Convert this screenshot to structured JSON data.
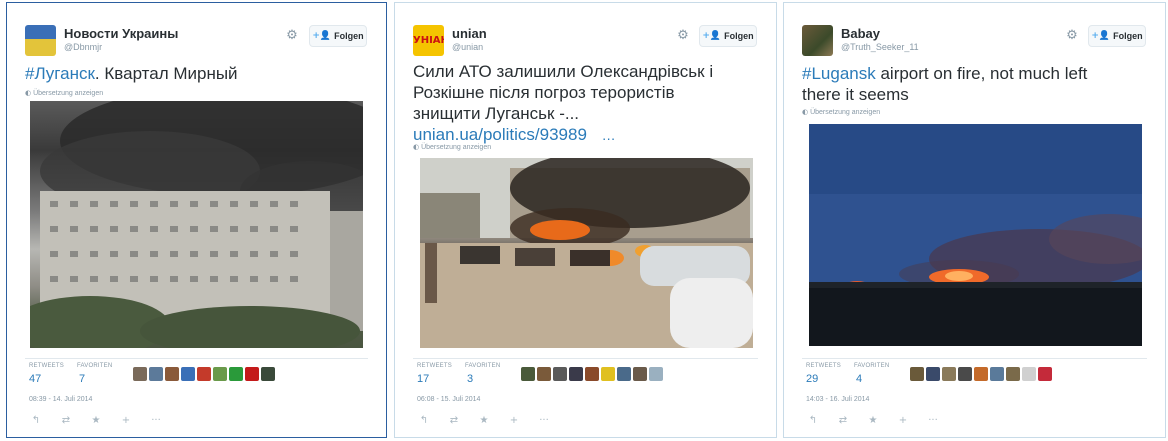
{
  "follow_label": "Folgen",
  "translate_label": "Übersetzung anzeigen",
  "retweets_label": "RETWEETS",
  "favorites_label": "FAVORITEN",
  "tweets": [
    {
      "fullname": "Новости Украины",
      "handle": "@Dbnmjr",
      "hashtag": "#Луганск",
      "text_after": ". Квартал Мирный",
      "retweets": "47",
      "favorites": "7",
      "timestamp": "08:39 - 14. Juli 2014",
      "favoriter_colors": [
        "#7a6a5a",
        "#5c7a9a",
        "#8a5a3a",
        "#3a6fb7",
        "#c43a2a",
        "#6a9a4a",
        "#2a9a3a",
        "#c41a1a",
        "#3a4a3a"
      ]
    },
    {
      "fullname": "unian",
      "handle": "@unian",
      "avatar_text": "УНІАН",
      "line1": "Сили АТО залишили Олександрівськ і",
      "line2": "Розкішне після погроз терористів",
      "line3": "знищити Луганськ -...",
      "link": "unian.ua/politics/93989",
      "link_suffix": "…",
      "retweets": "17",
      "favorites": "3",
      "timestamp": "06:08 - 15. Juli 2014",
      "favoriter_colors": [
        "#4a5a3a",
        "#7a5a3a",
        "#5a5a5a",
        "#3a3a4a",
        "#8a4a2a",
        "#e0c020",
        "#4a6a8a",
        "#6a5a4a",
        "#9ab0c0"
      ]
    },
    {
      "fullname": "Babay",
      "handle": "@Truth_Seeker_11",
      "hashtag": "#Lugansk",
      "text_after": " airport on fire, not much left",
      "line2": "there it seems",
      "retweets": "29",
      "favorites": "4",
      "timestamp": "14:03 - 16. Juli 2014",
      "favoriter_colors": [
        "#6a5a3a",
        "#3a4a6a",
        "#8a7a5a",
        "#4a4a4a",
        "#c46a2a",
        "#5a7a9a",
        "#7a6a4a",
        "#d0d0d0",
        "#c42a3a"
      ]
    }
  ],
  "icons": {
    "gear": "gear-icon",
    "follow": "follow-person-icon",
    "translate": "globe-icon",
    "reply": "reply-icon",
    "retweet": "retweet-icon",
    "favorite": "star-icon",
    "follow_action": "follow-action-icon",
    "more": "more-icon"
  }
}
